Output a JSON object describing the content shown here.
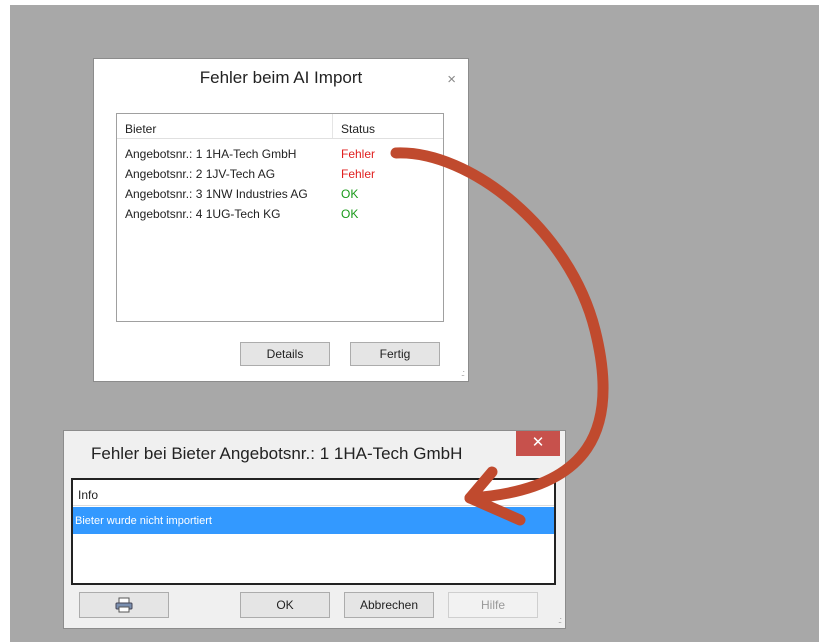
{
  "dialog1": {
    "title": "Fehler beim AI Import",
    "close_glyph": "×",
    "columns": [
      "Bieter",
      "Status"
    ],
    "rows": [
      {
        "bieter": "Angebotsnr.: 1 1HA-Tech GmbH",
        "status": "Fehler"
      },
      {
        "bieter": "Angebotsnr.: 2 1JV-Tech AG",
        "status": "Fehler"
      },
      {
        "bieter": "Angebotsnr.: 3 1NW Industries AG",
        "status": "OK"
      },
      {
        "bieter": "Angebotsnr.: 4 1UG-Tech KG",
        "status": "OK"
      }
    ],
    "buttons": {
      "details": "Details",
      "fertig": "Fertig"
    }
  },
  "dialog2": {
    "title": "Fehler bei Bieter Angebotsnr.: 1 1HA-Tech GmbH",
    "close_glyph": "✕",
    "column": "Info",
    "selected_row": "Bieter wurde nicht importiert",
    "buttons": {
      "print_icon": "printer-icon",
      "ok": "OK",
      "abbrechen": "Abbrechen",
      "hilfe": "Hilfe"
    }
  },
  "colors": {
    "status_error": "#e02020",
    "status_ok": "#1a9a1a",
    "annotation_arrow": "#c04a2e",
    "selection": "#3399ff",
    "close_button": "#c7514c"
  }
}
